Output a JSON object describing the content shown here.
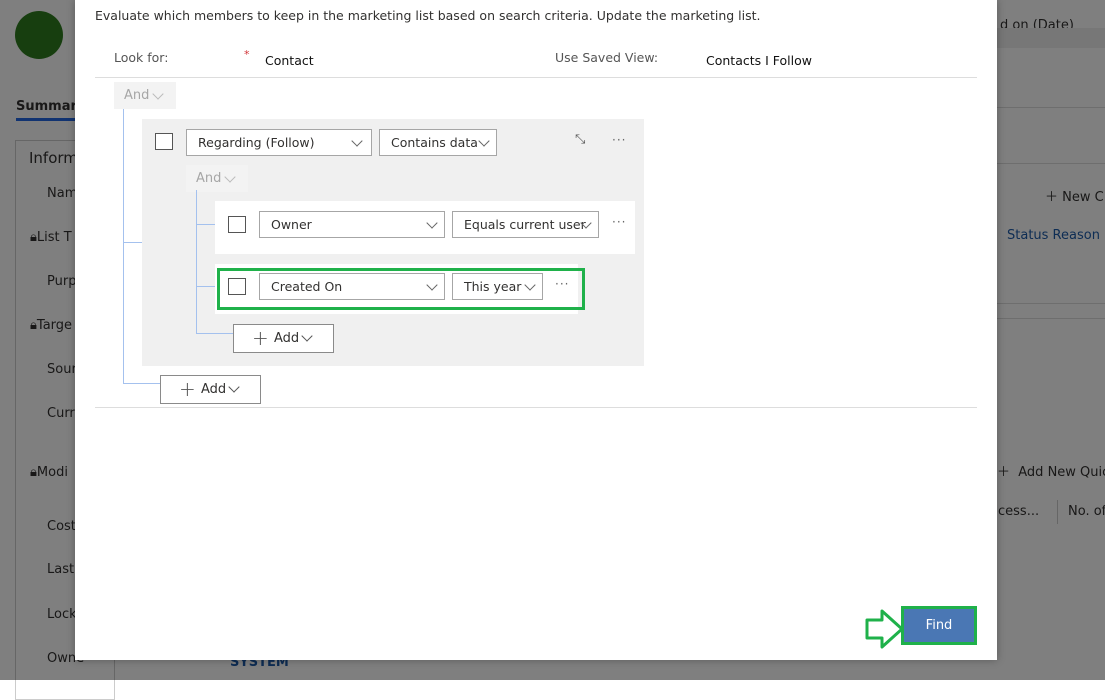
{
  "background": {
    "summary_tab": "Summary",
    "section_title": "Informa",
    "fields": [
      "Name",
      "List T",
      "Purp",
      "Targe",
      "Sour",
      "Curre",
      "Modi",
      "Cost",
      "Last",
      "Locke",
      "Owne"
    ],
    "owner_value": "SYSTEM",
    "right_header": "d on (Date)",
    "new_button": "New C",
    "status_reason_col": "Status Reason",
    "add_quick_button": "Add New Quick",
    "col_process": "cess...",
    "col_no_of": "No. of"
  },
  "dialog": {
    "description": "Evaluate which members to keep in the marketing list based on search criteria. Update the marketing list.",
    "look_for_label": "Look for:",
    "required_mark": "*",
    "look_for_value": "Contact",
    "saved_view_label": "Use Saved View:",
    "saved_view_value": "Contacts I Follow",
    "root_operator": "And",
    "group": {
      "field": "Regarding (Follow)",
      "operator": "Contains data",
      "inner_operator": "And",
      "conditions": [
        {
          "field": "Owner",
          "operator": "Equals current user"
        },
        {
          "field": "Created On",
          "operator": "This year"
        }
      ],
      "add_label": "Add"
    },
    "add_label": "Add",
    "ellipsis": "···",
    "find_label": "Find"
  },
  "colors": {
    "highlight": "#1fb14a",
    "find_button": "#4a77b4",
    "connector": "#a4c1ee"
  }
}
